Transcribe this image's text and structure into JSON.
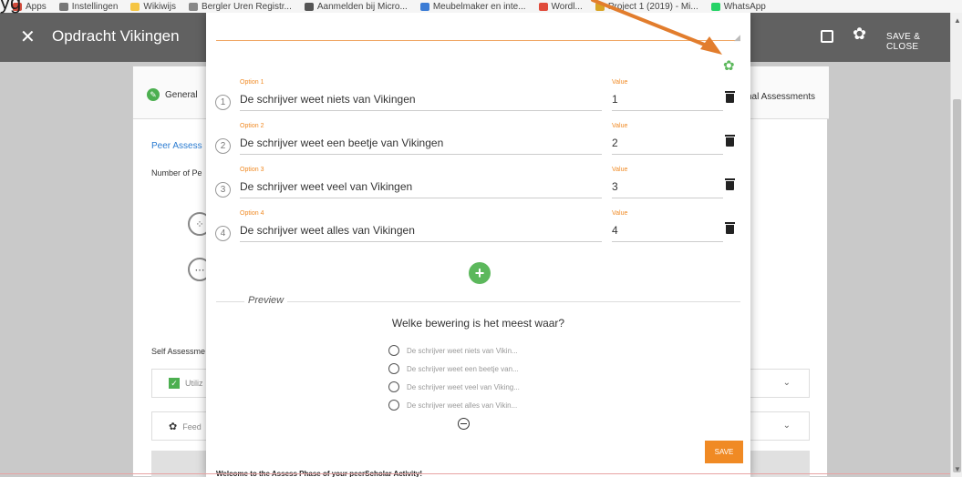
{
  "crop_text": "yg",
  "bookmarks": [
    {
      "label": "Apps",
      "color": "#d04a3a"
    },
    {
      "label": "Instellingen",
      "color": "#777777"
    },
    {
      "label": "Wikiwijs",
      "color": "#f5c542"
    },
    {
      "label": "Bergler Uren Registr...",
      "color": "#888888"
    },
    {
      "label": "Aanmelden bij Micro...",
      "color": "#555555"
    },
    {
      "label": "Meubelmaker en inte...",
      "color": "#3a7bd5"
    },
    {
      "label": "Wordl...",
      "color": "#e04b3b"
    },
    {
      "label": "Project 1 (2019) - Mi...",
      "color": "#d9a425"
    },
    {
      "label": "WhatsApp",
      "color": "#25d366"
    }
  ],
  "header": {
    "close_glyph": "✕",
    "title": "Opdracht Vikingen",
    "save_close": "SAVE & CLOSE"
  },
  "background": {
    "tab_general": "General",
    "tab_assessments": "nal Assessments",
    "peer_assess": "Peer Assess",
    "number_of": "Number of Pe",
    "self_assess": "Self Assessme",
    "utilize": "Utiliz",
    "feed": "Feed"
  },
  "modal": {
    "options": [
      {
        "number": "1",
        "option_label": "Option 1",
        "text": "De schrijver weet niets van Vikingen",
        "value_label": "Value",
        "value": "1"
      },
      {
        "number": "2",
        "option_label": "Option 2",
        "text": "De schrijver weet een beetje van Vikingen",
        "value_label": "Value",
        "value": "2"
      },
      {
        "number": "3",
        "option_label": "Option 3",
        "text": "De schrijver weet veel van Vikingen",
        "value_label": "Value",
        "value": "3"
      },
      {
        "number": "4",
        "option_label": "Option 4",
        "text": "De schrijver weet alles van Vikingen",
        "value_label": "Value",
        "value": "4"
      }
    ],
    "add_glyph": "+",
    "preview_label": "Preview",
    "preview_question": "Welke bewering is het meest waar?",
    "preview_options": [
      "De schrijver weet niets van Vikin...",
      "De schrijver weet een beetje van...",
      "De schrijver weet veel van Viking...",
      "De schrijver weet alles van Vikin..."
    ],
    "save_label": "SAVE",
    "footer_text": "Welcome to the Assess Phase of your peerScholar Activity!"
  },
  "colors": {
    "accent_orange": "#f08a24",
    "green": "#5cb85c",
    "header_grey": "#616161"
  }
}
